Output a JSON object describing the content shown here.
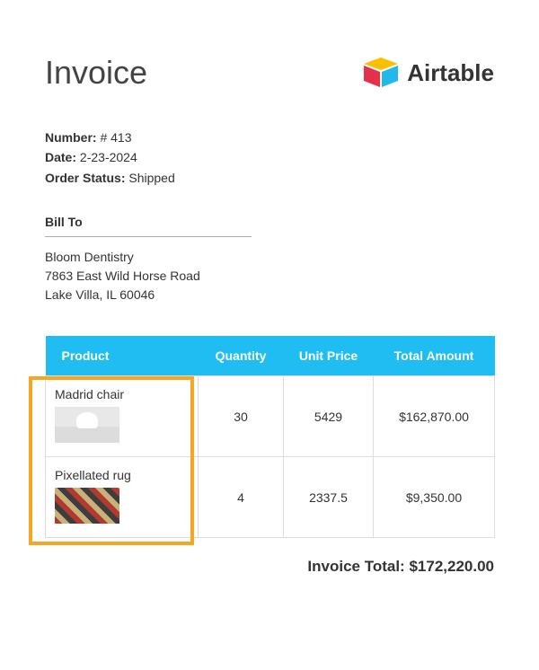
{
  "title": "Invoice",
  "brand": {
    "name": "Airtable"
  },
  "meta": {
    "number_label": "Number",
    "number_value": "# 413",
    "date_label": "Date",
    "date_value": "2-23-2024",
    "status_label": "Order Status",
    "status_value": "Shipped"
  },
  "bill_to": {
    "heading": "Bill To",
    "name": "Bloom Dentistry",
    "street": "7863 East Wild Horse Road",
    "city_line": "Lake Villa, IL 60046"
  },
  "columns": {
    "product": "Product",
    "quantity": "Quantity",
    "unit_price": "Unit Price",
    "total": "Total Amount"
  },
  "rows": [
    {
      "product": "Madrid chair",
      "quantity": "30",
      "unit_price": "5429",
      "total": "$162,870.00"
    },
    {
      "product": "Pixellated rug",
      "quantity": "4",
      "unit_price": "2337.5",
      "total": "$9,350.00"
    }
  ],
  "invoice_total_label": "Invoice Total:",
  "invoice_total_value": "$172,220.00"
}
